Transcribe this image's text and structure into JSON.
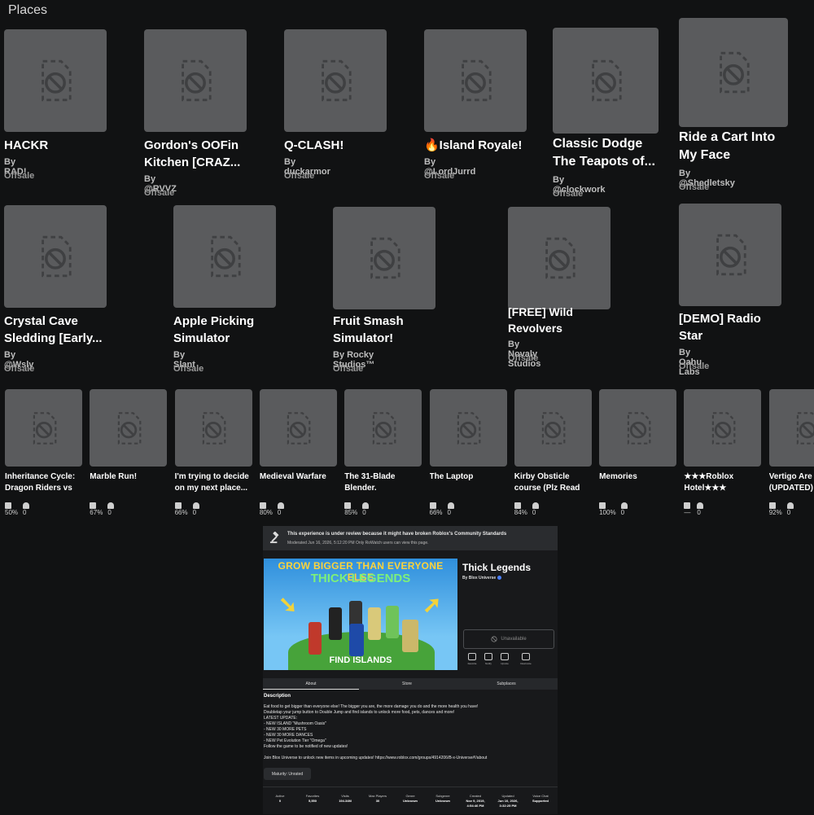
{
  "section_title": "Places",
  "row1": [
    {
      "title": "HACKR",
      "by": "By RAD!",
      "status": "Offsale"
    },
    {
      "title": "Gordon's OOFin\nKitchen [CRAZ...",
      "by": "By @RVVZ",
      "status": "Offsale"
    },
    {
      "title": "Q-CLASH!",
      "by": "By duckarmor",
      "status": "Offsale"
    },
    {
      "title": "🔥Island Royale!",
      "by": "By @LordJurrd",
      "status": "Offsale"
    },
    {
      "title": "Classic Dodge\nThe Teapots of...",
      "by": "By @clockwork",
      "status": "Offsale"
    },
    {
      "title": "Ride a Cart Into\nMy Face",
      "by": "By @Shedletsky",
      "status": "Offsale"
    }
  ],
  "row2": [
    {
      "title": "Crystal Cave\nSledding [Early...",
      "by": "By @Wsly",
      "status": "Offsale"
    },
    {
      "title": "Apple Picking\nSimulator",
      "by": "By Slant",
      "status": "Offsale"
    },
    {
      "title": "Fruit Smash\nSimulator!",
      "by": "By Rocky Studios™",
      "status": "Offsale"
    },
    {
      "title": "[FREE] Wild\nRevolvers",
      "by": "By Novaly Studios",
      "status": "Offsale"
    },
    {
      "title": "[DEMO] Radio\nStar",
      "by": "By Oahu Labs",
      "status": "Offsale"
    }
  ],
  "row3": [
    {
      "title": "Inheritance Cycle:\nDragon Riders vs",
      "rating": "50%",
      "players": "0"
    },
    {
      "title": "Marble Run!",
      "rating": "67%",
      "players": "0"
    },
    {
      "title": "I'm trying to decide\non my next place...",
      "rating": "66%",
      "players": "0"
    },
    {
      "title": "Medieval Warfare",
      "rating": "80%",
      "players": "0"
    },
    {
      "title": "The 31-Blade\nBlender.",
      "rating": "85%",
      "players": "0"
    },
    {
      "title": "The Laptop",
      "rating": "66%",
      "players": "0"
    },
    {
      "title": "Kirby Obsticle\ncourse (Plz Read",
      "rating": "84%",
      "players": "0"
    },
    {
      "title": "Memories",
      "rating": "100%",
      "players": "0"
    },
    {
      "title": "★★★Roblox\nHotel★★★",
      "rating": "—",
      "players": "0"
    },
    {
      "title": "Vertigo Are\n(UPDATED)",
      "rating": "92%",
      "players": "0"
    }
  ],
  "detail": {
    "banner_title": "This experience is under review because it might have broken Roblox's Community Standards",
    "banner_sub": "Moderated Jun 16, 2026, 5:12:20 PM Only RoWatch users can view this page.",
    "thumb_line1": "GROW BIGGER THAN EVERYONE ELSE",
    "thumb_line2": "THICK LEGENDS",
    "thumb_line3": "FIND ISLANDS",
    "game_title": "Thick Legends",
    "game_by": "By Blox Universe",
    "unavailable": "Unavailable",
    "actions": [
      "Favorite",
      "Notify",
      "Upvote",
      "Downvote"
    ],
    "tabs": [
      "About",
      "Store",
      "Subplaces"
    ],
    "desc_title": "Description",
    "description": "Eat food to get bigger than everyone else! The bigger you are, the more damage you do and the more health you have!\nDoubletap your jump button to Double Jump and find islands to unlock more food, pets, dances and more!\nLATEST UPDATE:\n- NEW ISLAND \"Mushroom Oasis\"\n- NEW 30 MORE PETS\n- NEW 30 MORE DANCES\n- NEW Pet Evolution Tier \"Omega\"\nFollow the game to be notified of new updates!\n\nJoin Blox Universe to unlock new items in upcoming updates! https://www.roblox.com/groups/4914206/B-x-Universe#!/about",
    "maturity": "Maturity: Unrated",
    "stats": [
      {
        "label": "Active",
        "value": "0"
      },
      {
        "label": "Favorites",
        "value": "5,550"
      },
      {
        "label": "Visits",
        "value": "194.34M"
      },
      {
        "label": "Max Players",
        "value": "30"
      },
      {
        "label": "Genre",
        "value": "Unknown"
      },
      {
        "label": "Subgenre",
        "value": "Unknown"
      },
      {
        "label": "Created",
        "value": "Nov 9, 2019,\n4:54:46 PM"
      },
      {
        "label": "Updated",
        "value": "Jun 10, 2026,\n3:32:25 PM"
      },
      {
        "label": "Voice Chat",
        "value": "Supported"
      }
    ]
  }
}
